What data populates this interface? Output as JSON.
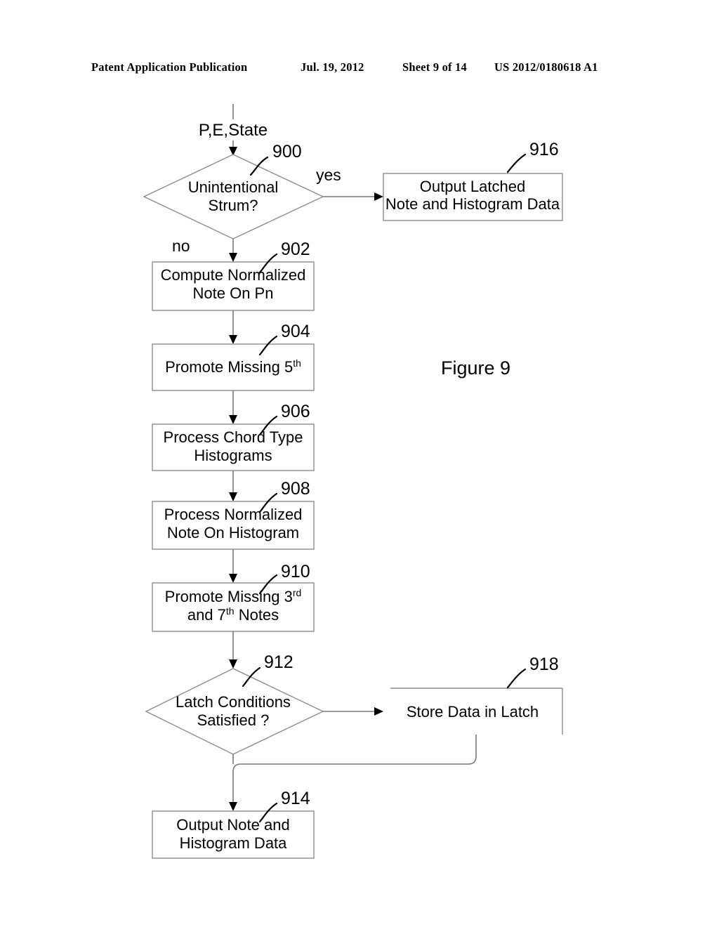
{
  "header": {
    "publication": "Patent Application Publication",
    "date": "Jul. 19, 2012",
    "sheet": "Sheet 9 of 14",
    "patent_number": "US 2012/0180618 A1"
  },
  "figure": {
    "caption": "Figure 9",
    "input_label": "P,E,State"
  },
  "branches": {
    "yes": "yes",
    "no": "no"
  },
  "nodes": {
    "n900": {
      "ref": "900",
      "type": "decision",
      "line1": "Unintentional",
      "line2": "Strum?"
    },
    "n902": {
      "ref": "902",
      "type": "process",
      "line1": "Compute Normalized",
      "line2": "Note On Pn"
    },
    "n904": {
      "ref": "904",
      "type": "process",
      "line1_a": "Promote Missing 5",
      "line1_sup": "th",
      "line2": ""
    },
    "n906": {
      "ref": "906",
      "type": "process",
      "line1": "Process Chord Type",
      "line2": "Histograms"
    },
    "n908": {
      "ref": "908",
      "type": "process",
      "line1": "Process Normalized",
      "line2": "Note On  Histogram"
    },
    "n910": {
      "ref": "910",
      "type": "process",
      "line1_a": "Promote Missing 3",
      "line1_sup": "rd",
      "line2_a": "and 7",
      "line2_sup": "th",
      "line2_b": " Notes"
    },
    "n912": {
      "ref": "912",
      "type": "decision",
      "line1": "Latch Conditions",
      "line2": "Satisfied ?"
    },
    "n914": {
      "ref": "914",
      "type": "process",
      "line1": "Output Note and",
      "line2": "Histogram Data"
    },
    "n916": {
      "ref": "916",
      "type": "process",
      "line1": "Output Latched",
      "line2": "Note and Histogram Data"
    },
    "n918": {
      "ref": "918",
      "type": "process",
      "line1": "Store Data in Latch",
      "line2": ""
    }
  },
  "colors": {
    "ink": "#000000",
    "shape_stroke": "#8c8c8c",
    "connector": "#7a7a7a",
    "background": "#ffffff"
  }
}
